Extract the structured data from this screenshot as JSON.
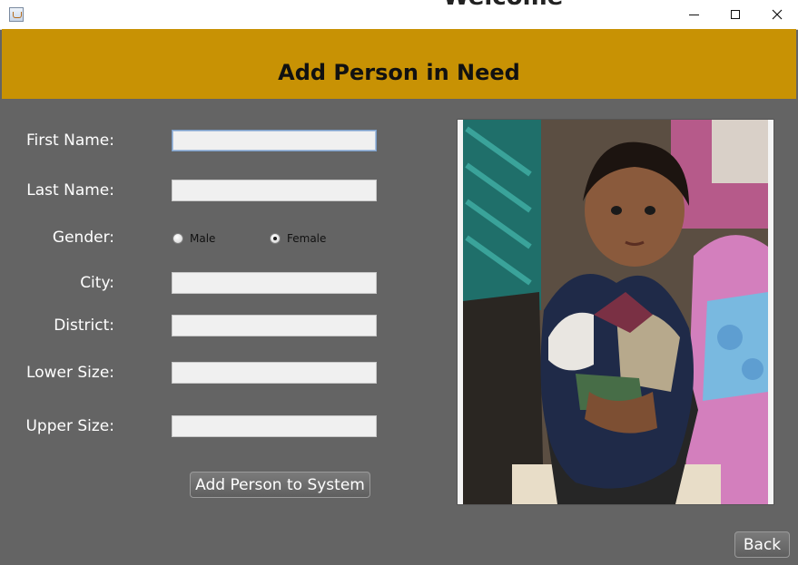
{
  "window": {
    "background_text": "Welcome",
    "controls": {
      "minimize": "–",
      "maximize": "□",
      "close": "✕"
    }
  },
  "header": {
    "title": "Add Person in Need",
    "color": "#c89204"
  },
  "form": {
    "first_name_label": "First Name:",
    "first_name_value": "",
    "last_name_label": "Last Name:",
    "last_name_value": "",
    "gender_label": "Gender:",
    "gender_options": [
      "Male",
      "Female"
    ],
    "gender_selected": "Female",
    "city_label": "City:",
    "city_value": "",
    "district_label": "District:",
    "district_value": "",
    "lower_size_label": "Lower Size:",
    "lower_size_value": "",
    "upper_size_label": "Upper Size:",
    "upper_size_value": "",
    "submit_label": "Add Person to System"
  },
  "photo": {
    "subject": "child holding clothes"
  },
  "footer": {
    "back_label": "Back"
  }
}
